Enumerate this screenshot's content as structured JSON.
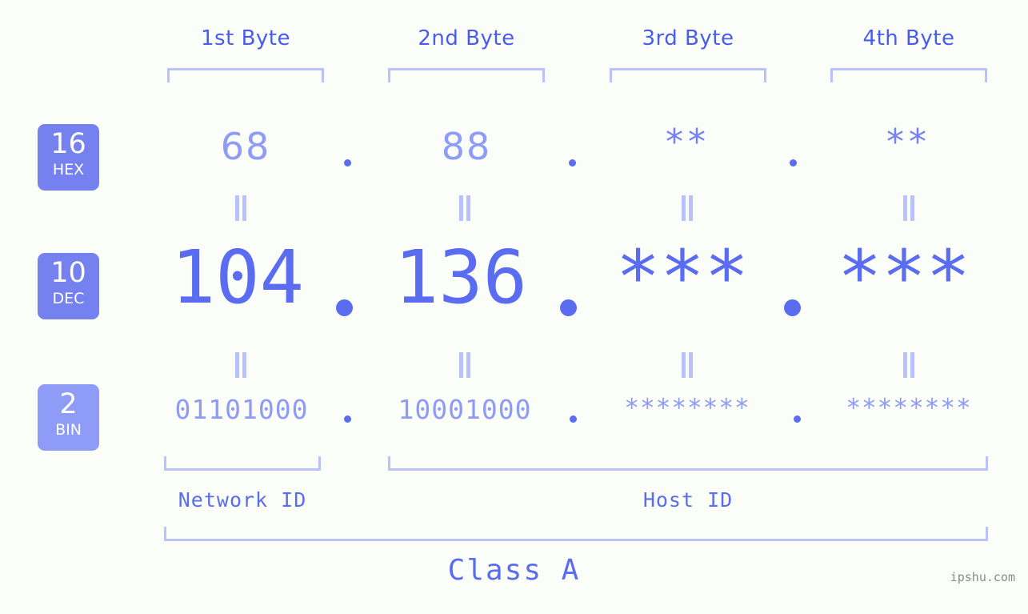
{
  "page": {
    "background_color": "#fbfdf8",
    "accent_dark": "#4a5cee",
    "accent_mid": "#5a6cf0",
    "accent_light": "#8e9bf7",
    "accent_pale": "#b9c2fb",
    "watermark": "ipshu.com"
  },
  "byte_headers": [
    {
      "label": "1st Byte"
    },
    {
      "label": "2nd Byte"
    },
    {
      "label": "3rd Byte"
    },
    {
      "label": "4th Byte"
    }
  ],
  "bases": [
    {
      "number": "16",
      "name": "HEX"
    },
    {
      "number": "10",
      "name": "DEC"
    },
    {
      "number": "2",
      "name": "BIN"
    }
  ],
  "rows": {
    "hex": {
      "base_number": "16",
      "base_name": "HEX",
      "values": [
        "68",
        "88",
        "**",
        "**"
      ],
      "separators": [
        ".",
        ".",
        "."
      ]
    },
    "dec": {
      "base_number": "10",
      "base_name": "DEC",
      "values": [
        "104",
        "136",
        "***",
        "***"
      ],
      "separators": [
        ".",
        ".",
        "."
      ]
    },
    "bin": {
      "base_number": "2",
      "base_name": "BIN",
      "values": [
        "01101000",
        "10001000",
        "********",
        "********"
      ],
      "separators": [
        ".",
        ".",
        "."
      ]
    }
  },
  "equals_marks": {
    "glyph": "=",
    "count_per_row": 4
  },
  "id_sections": [
    {
      "label": "Network ID"
    },
    {
      "label": "Host ID"
    }
  ],
  "class": {
    "label": "Class A"
  }
}
